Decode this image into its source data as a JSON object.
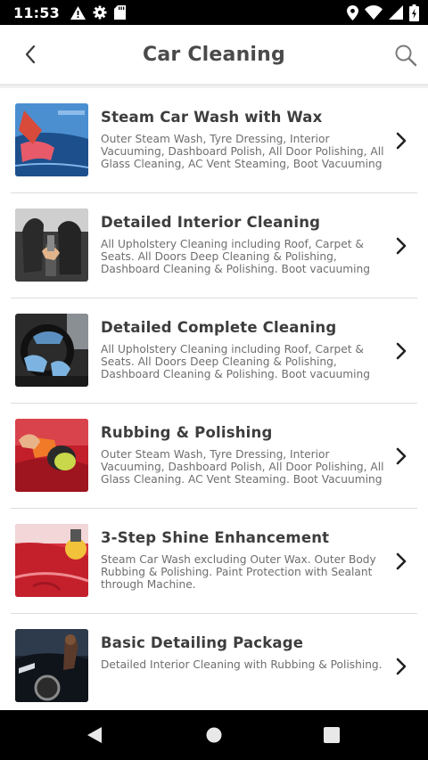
{
  "status_bar": {
    "time": "11:53",
    "left_icons": [
      "alert-icon",
      "gear-icon",
      "sd-card-icon"
    ],
    "right_icons": [
      "location-icon",
      "wifi-icon",
      "signal-icon",
      "battery-icon"
    ]
  },
  "header": {
    "title": "Car Cleaning",
    "back_icon": "chevron-left-icon",
    "search_icon": "search-icon"
  },
  "services": [
    {
      "title": "Steam Car Wash with Wax",
      "description": "Outer Steam Wash, Tyre Dressing, Interior Vacuuming, Dashboard Polish, All Door Polishing, All Glass Cleaning, AC Vent Steaming, Boot Vacuuming"
    },
    {
      "title": "Detailed Interior Cleaning",
      "description": "All Upholstery Cleaning including Roof, Carpet & Seats. All Doors Deep Cleaning & Polishing, Dashboard Cleaning & Polishing. Boot vacuuming"
    },
    {
      "title": "Detailed Complete Cleaning",
      "description": "All Upholstery Cleaning including Roof, Carpet & Seats. All Doors Deep Cleaning & Polishing, Dashboard Cleaning & Polishing. Boot vacuuming"
    },
    {
      "title": "Rubbing & Polishing",
      "description": "Outer Steam Wash, Tyre Dressing, Interior Vacuuming, Dashboard Polish, All Door Polishing, All Glass Cleaning. AC Vent Steaming. Boot Vacuuming"
    },
    {
      "title": "3-Step Shine Enhancement",
      "description": "Steam Car Wash excluding Outer Wax. Outer Body Rubbing & Polishing. Paint Protection with Sealant through Machine."
    },
    {
      "title": "Basic Detailing Package",
      "description": "Detailed Interior Cleaning with Rubbing & Polishing."
    }
  ],
  "nav_bar": {
    "icons": [
      "nav-back-icon",
      "nav-home-icon",
      "nav-recents-icon"
    ]
  },
  "colors": {
    "title_text": "#4a4a4a",
    "item_title": "#3d3d3d",
    "item_desc": "#6e6e6e",
    "divider": "#dddddd",
    "bars": "#000000"
  }
}
